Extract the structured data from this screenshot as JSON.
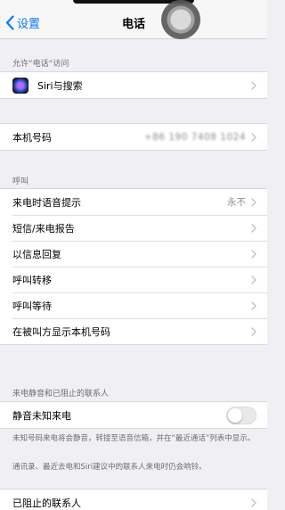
{
  "nav": {
    "back_label": "设置",
    "title": "电话"
  },
  "sections": {
    "allow_access": {
      "header": "允许“电话”访问",
      "siri_label": "Siri与搜索"
    },
    "my_number": {
      "label": "本机号码",
      "value": "+86 190 7408 1024"
    },
    "calls": {
      "header": "呼叫",
      "items": [
        {
          "label": "来电时语音提示",
          "value": "永不"
        },
        {
          "label": "短信/来电报告",
          "value": ""
        },
        {
          "label": "以信息回复",
          "value": ""
        },
        {
          "label": "呼叫转移",
          "value": ""
        },
        {
          "label": "呼叫等待",
          "value": ""
        },
        {
          "label": "在被叫方显示本机号码",
          "value": ""
        }
      ]
    },
    "silence": {
      "header": "来电静音和已阻止的联系人",
      "toggle_label": "静音未知来电",
      "toggle_on": false,
      "footnote1": "未知号码来电将会静音，转接至语音信箱，并在“最近通话”列表中显示。",
      "footnote2": "通讯录、最近去电和Siri建议中的联系人来电时仍会响铃。",
      "blocked_label": "已阻止的联系人"
    }
  },
  "colors": {
    "accent": "#0a7aff",
    "background": "#efeff4",
    "secondary_text": "#8e8e93"
  }
}
